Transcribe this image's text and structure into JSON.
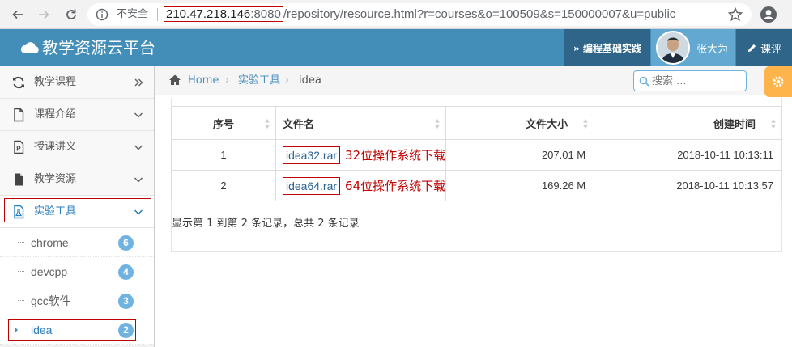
{
  "browser": {
    "security_label": "不安全",
    "url_host": "210.47.218.146",
    "url_port": ":8080",
    "url_path": "/repository/resource.html?r=courses&o=100509&s=150000007&u=public"
  },
  "header": {
    "brand": "教学资源云平台",
    "course_button": "» 编程基础实践",
    "user_name": "张大为",
    "eval_button": "课评"
  },
  "sidebar": {
    "items": [
      {
        "label": "教学课程",
        "icon": "refresh-icon"
      },
      {
        "label": "课程介绍",
        "icon": "file-icon"
      },
      {
        "label": "授课讲义",
        "icon": "ppt-file-icon"
      },
      {
        "label": "教学资源",
        "icon": "file-text-icon"
      },
      {
        "label": "实验工具",
        "icon": "flask-icon"
      }
    ],
    "subitems": [
      {
        "label": "chrome",
        "count": "6"
      },
      {
        "label": "devcpp",
        "count": "4"
      },
      {
        "label": "gcc软件",
        "count": "3"
      },
      {
        "label": "idea",
        "count": "2"
      }
    ]
  },
  "breadcrumb": {
    "home": "Home",
    "level1": "实验工具",
    "level2": "idea"
  },
  "search": {
    "placeholder": "搜索 ..."
  },
  "table": {
    "headers": [
      "序号",
      "文件名",
      "文件大小",
      "创建时间"
    ],
    "rows": [
      {
        "index": "1",
        "filename": "idea32.rar",
        "note": "32位操作系统下载",
        "size": "207.01 M",
        "created": "2018-10-11 10:13:11"
      },
      {
        "index": "2",
        "filename": "idea64.rar",
        "note": "64位操作系统下载",
        "size": "169.26 M",
        "created": "2018-10-11 10:13:57"
      }
    ],
    "summary": "显示第 1 到第 2 条记录，总共 2 条记录"
  },
  "colors": {
    "header_bg": "#438eb9",
    "header_dark": "#2e6589",
    "accent": "#2b7dbc",
    "badge": "#6fb3e0",
    "annotation_red": "#c00000",
    "gear_tab": "#ffb44b"
  }
}
